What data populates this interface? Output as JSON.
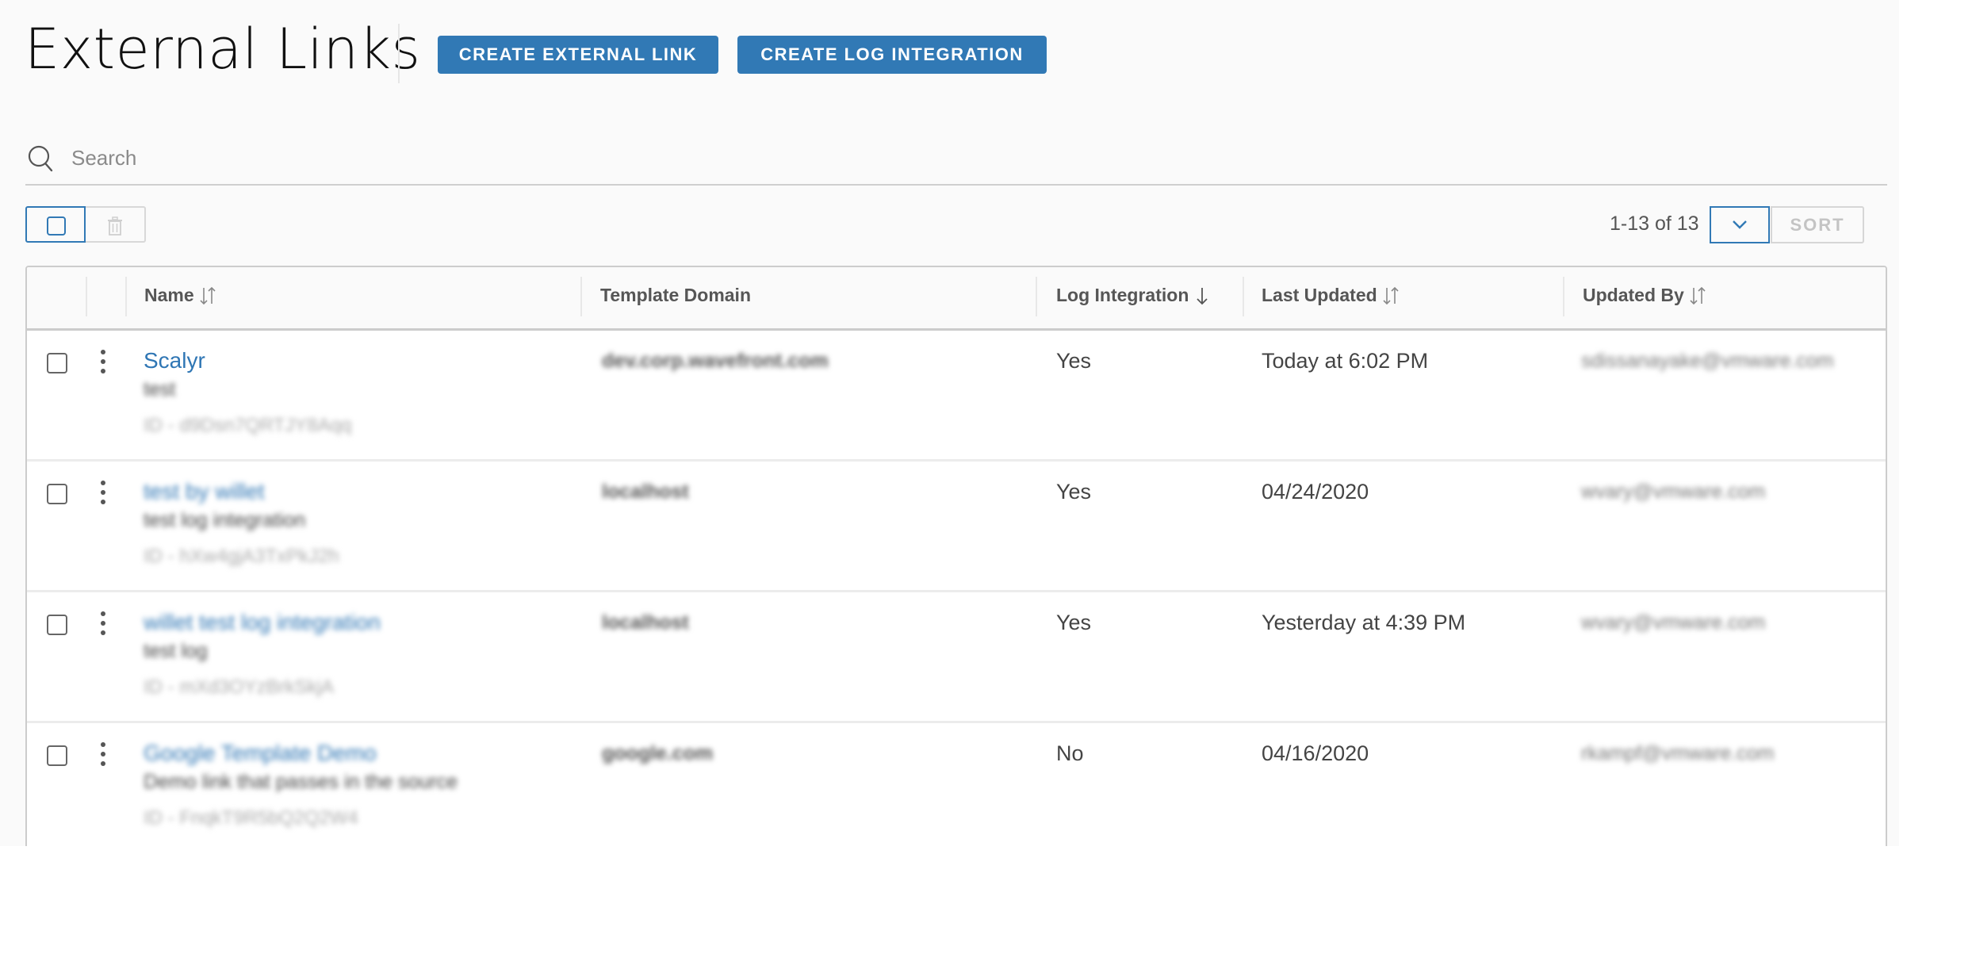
{
  "header": {
    "title": "External Links",
    "create_external_link_label": "CREATE EXTERNAL LINK",
    "create_log_integration_label": "CREATE LOG INTEGRATION"
  },
  "search": {
    "placeholder": "Search",
    "value": "",
    "icon": "search-icon"
  },
  "toolbar": {
    "select_all_icon": "checkbox-icon",
    "delete_icon": "trash-icon",
    "pagination": "1-13 of 13",
    "sort_dropdown_icon": "chevron-down-icon",
    "sort_label": "SORT"
  },
  "table": {
    "columns": [
      {
        "label": "Name",
        "sort": "unsorted"
      },
      {
        "label": "Template Domain",
        "sort": "none"
      },
      {
        "label": "Log Integration",
        "sort": "descending"
      },
      {
        "label": "Last Updated",
        "sort": "unsorted"
      },
      {
        "label": "Updated By",
        "sort": "unsorted"
      }
    ],
    "rows": [
      {
        "name": "Scalyr",
        "description": "test",
        "id": "ID - d9Dsn7QRTJY8Aqq",
        "domain": "dev.corp.wavefront.com",
        "log_integration": "Yes",
        "last_updated": "Today at 6:02 PM",
        "updated_by": "sdissanayake@vmware.com"
      },
      {
        "name": "test by willet",
        "description": "test log integration",
        "id": "ID - hXw4gjA3TxPkJ2h",
        "domain": "localhost",
        "log_integration": "Yes",
        "last_updated": "04/24/2020",
        "updated_by": "wvary@vmware.com"
      },
      {
        "name": "willet test log integration",
        "description": "test log",
        "id": "ID - mXd3OYzBrkSkjA",
        "domain": "localhost",
        "log_integration": "Yes",
        "last_updated": "Yesterday at 4:39 PM",
        "updated_by": "wvary@vmware.com"
      },
      {
        "name": "Google Template Demo",
        "description": "Demo link that passes in the source",
        "id": "ID - FnqkT9R5bQ2Q2W4",
        "domain": "google.com",
        "log_integration": "No",
        "last_updated": "04/16/2020",
        "updated_by": "rkampf@vmware.com"
      }
    ]
  },
  "colors": {
    "primary": "#3179b5",
    "link": "#2f76b4",
    "page_bg": "#fafafa",
    "border": "#cccccc"
  }
}
